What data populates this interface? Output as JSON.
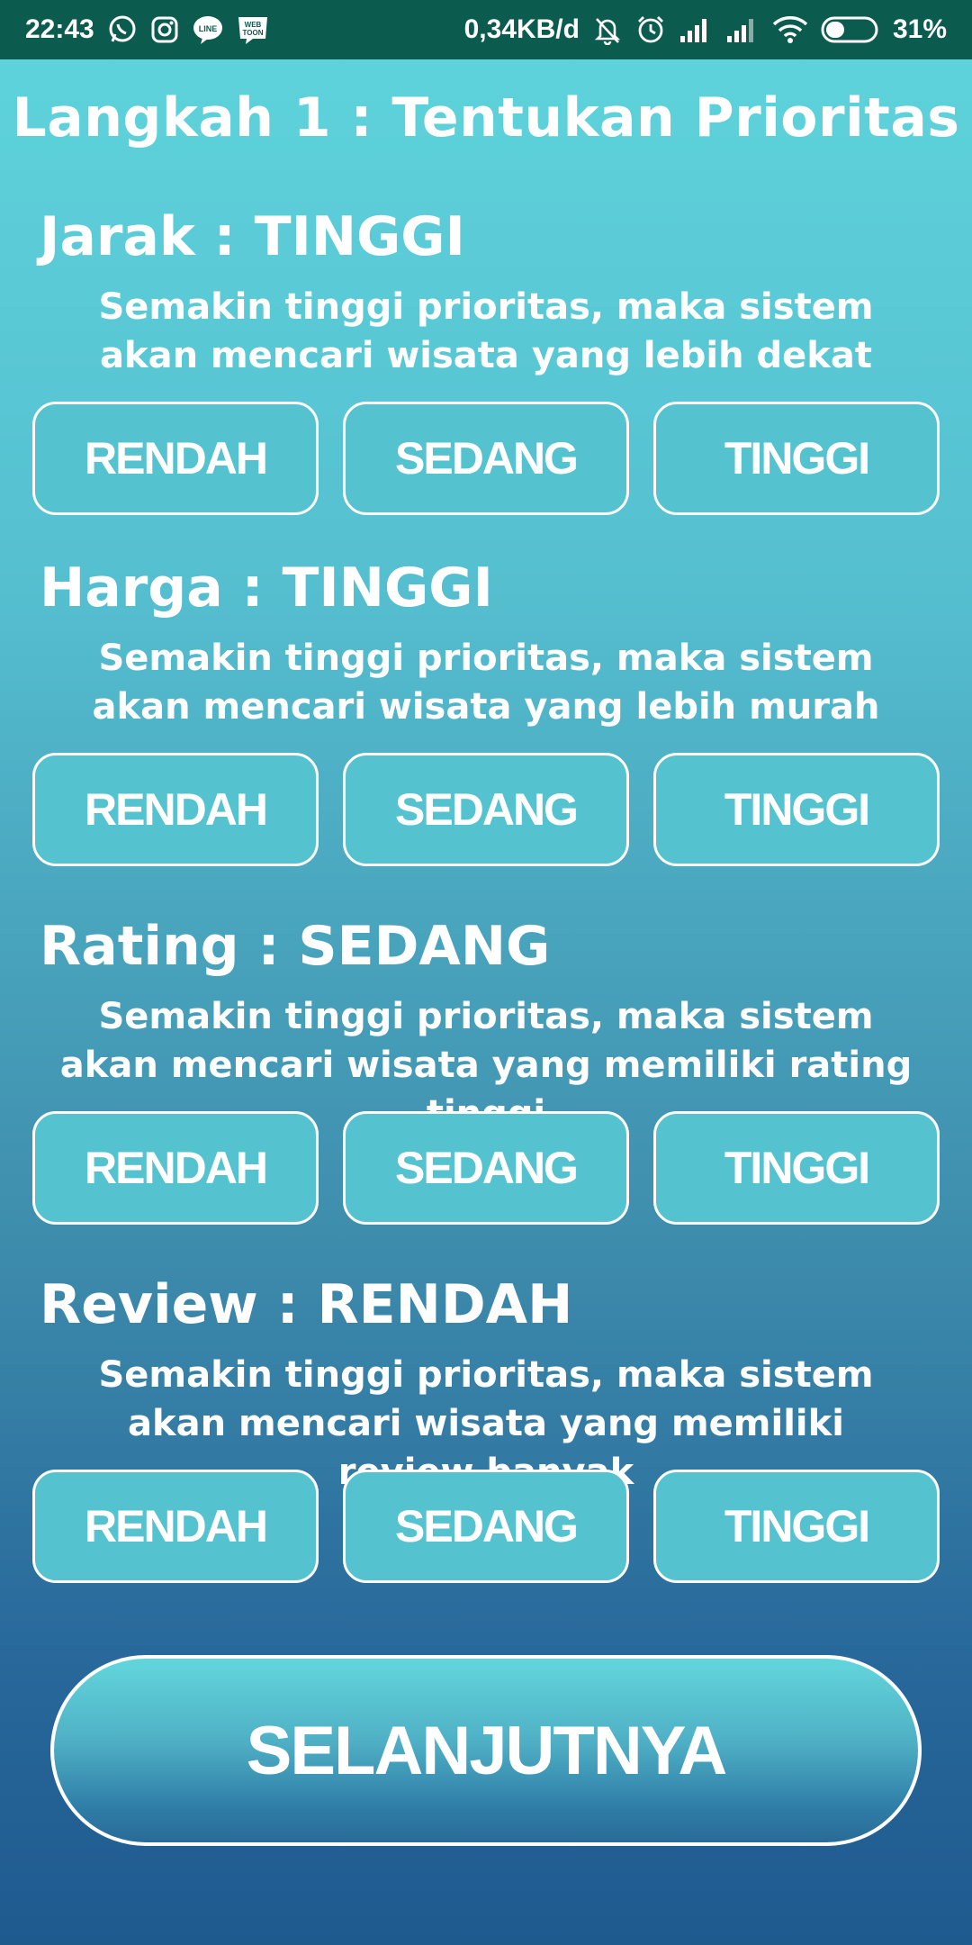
{
  "status_bar": {
    "time": "22:43",
    "network_speed": "0,34KB/d",
    "battery": "31%",
    "left_icons": [
      "whatsapp-icon",
      "instagram-icon",
      "line-icon",
      "webtoon-icon"
    ],
    "right_icons": [
      "mute-icon",
      "alarm-icon",
      "signal-icon",
      "signal-icon",
      "wifi-icon",
      "battery-icon"
    ]
  },
  "page": {
    "title": "Langkah 1 : Tentukan Prioritas"
  },
  "sections": [
    {
      "heading": "Jarak : TINGGI",
      "description": "Semakin tinggi prioritas, maka sistem akan mencari wisata yang lebih dekat",
      "options": [
        "RENDAH",
        "SEDANG",
        "TINGGI"
      ]
    },
    {
      "heading": "Harga : TINGGI",
      "description": "Semakin tinggi prioritas, maka sistem akan mencari wisata yang lebih murah",
      "options": [
        "RENDAH",
        "SEDANG",
        "TINGGI"
      ]
    },
    {
      "heading": "Rating : SEDANG",
      "description": "Semakin tinggi prioritas, maka sistem akan mencari wisata yang memiliki rating tinggi",
      "options": [
        "RENDAH",
        "SEDANG",
        "TINGGI"
      ]
    },
    {
      "heading": "Review : RENDAH",
      "description": "Semakin tinggi prioritas, maka sistem akan mencari wisata yang memiliki review banyak",
      "options": [
        "RENDAH",
        "SEDANG",
        "TINGGI"
      ]
    }
  ],
  "next_button": {
    "label": "SELANJUTNYA"
  },
  "colors": {
    "status_bar_bg": "#0b5b4f",
    "button_fill": "#55c3cf",
    "button_border": "#ffffff",
    "gradient_top": "#5fd5dc",
    "gradient_bottom": "#1f5a8f"
  }
}
